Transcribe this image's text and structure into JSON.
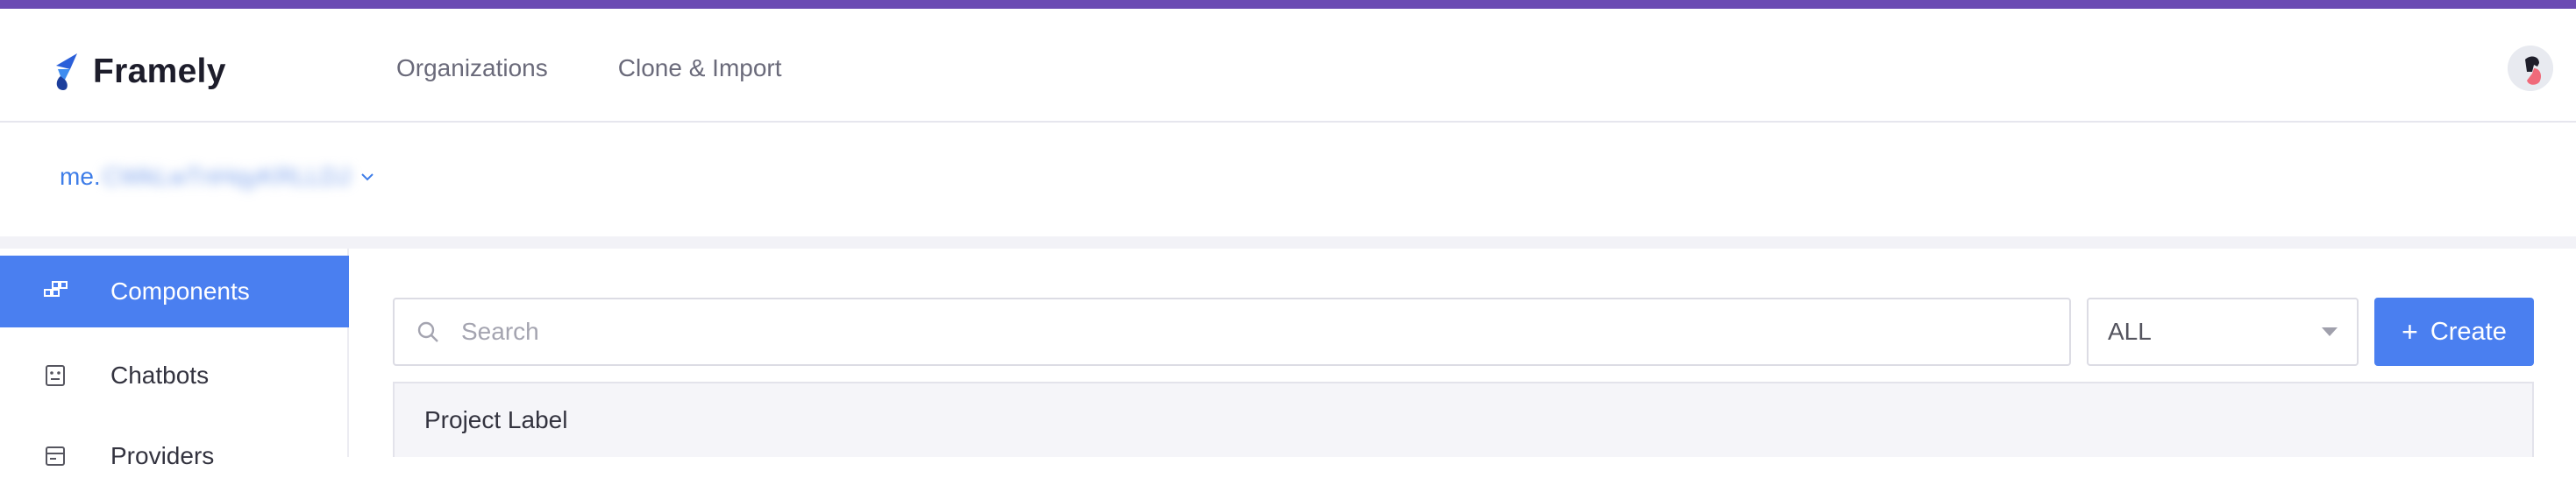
{
  "app": {
    "name": "Framely",
    "accent_color": "#6b4bb3",
    "primary_color": "#4a7ff0"
  },
  "header": {
    "nav": [
      {
        "label": "Organizations"
      },
      {
        "label": "Clone & Import"
      }
    ],
    "avatar_icon": "user-avatar-icon"
  },
  "org": {
    "prefix": "me.",
    "id": "CWkLwTnHqyKRLLDJ"
  },
  "sidebar": {
    "items": [
      {
        "label": "Components",
        "icon": "components-icon",
        "active": true
      },
      {
        "label": "Chatbots",
        "icon": "chatbot-icon",
        "active": false
      },
      {
        "label": "Providers",
        "icon": "providers-icon",
        "active": false
      }
    ]
  },
  "toolbar": {
    "search_placeholder": "Search",
    "search_value": "",
    "filter_value": "ALL",
    "create_label": "Create"
  },
  "table": {
    "columns": [
      "Project Label"
    ]
  }
}
